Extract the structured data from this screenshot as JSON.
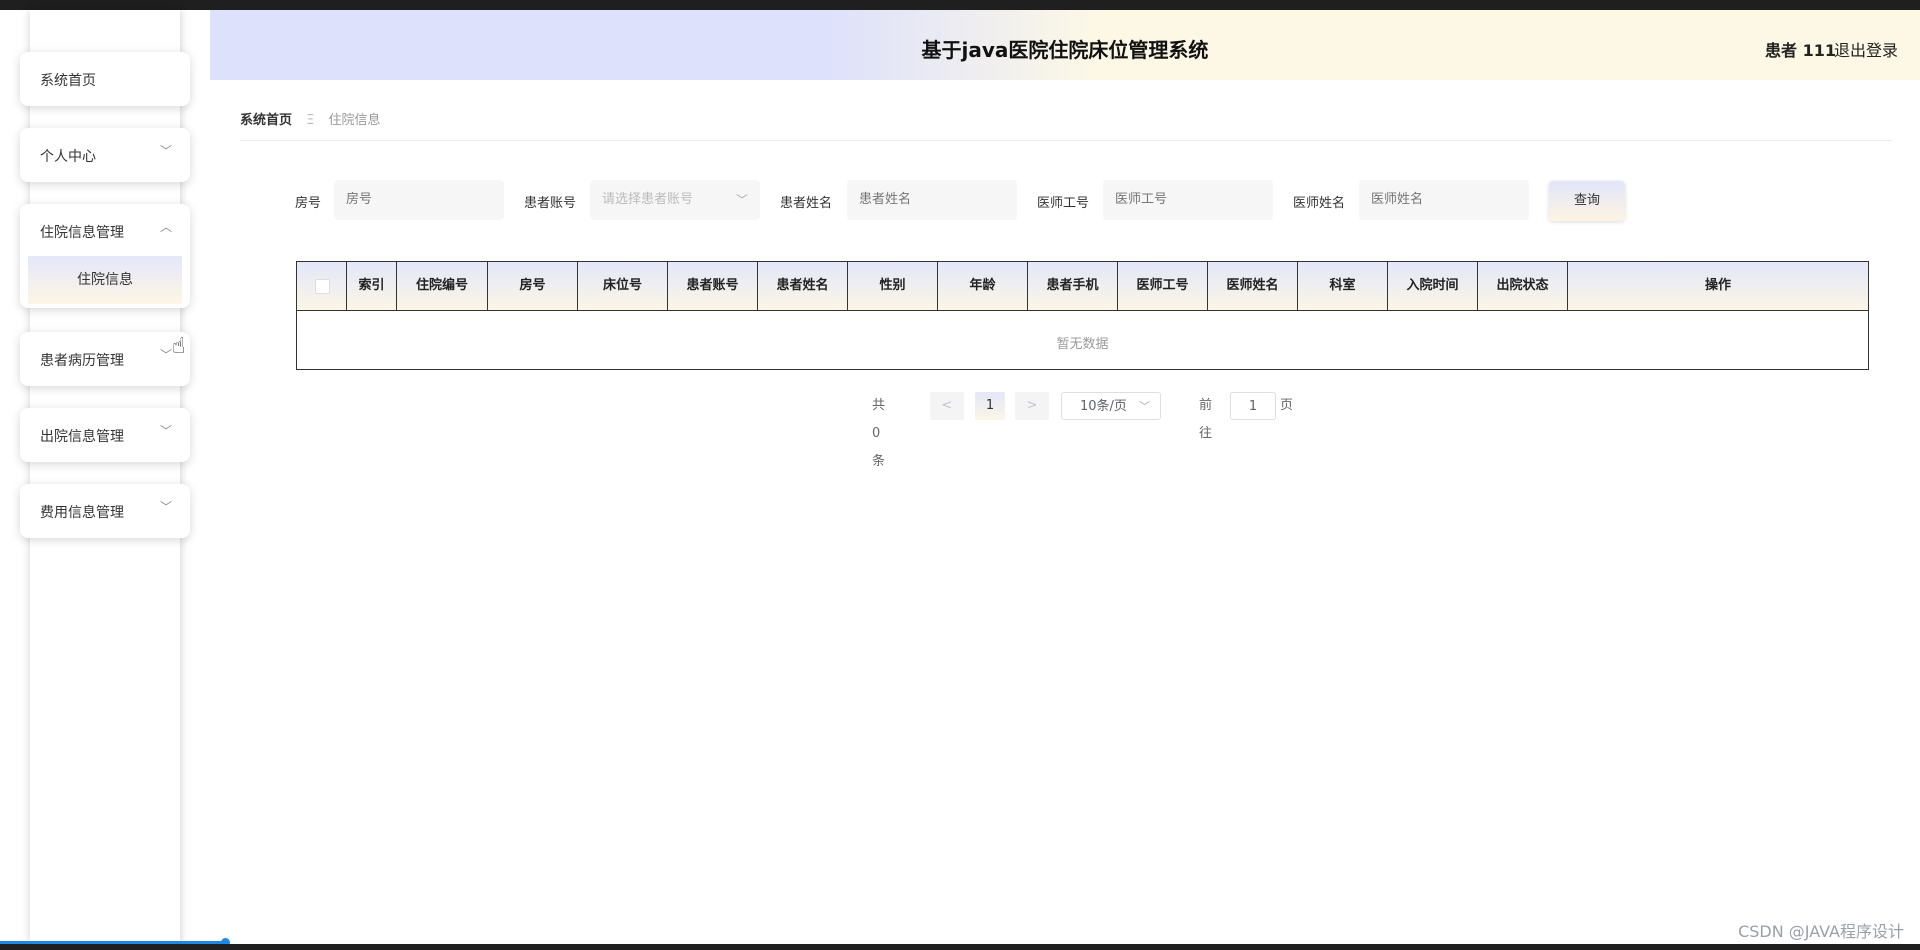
{
  "header": {
    "title": "基于java医院住院床位管理系统",
    "user": "患者 111",
    "logout": "退出登录"
  },
  "sidebar": {
    "items": [
      {
        "label": "系统首页",
        "has_children": false
      },
      {
        "label": "个人中心",
        "has_children": true,
        "expanded": false
      },
      {
        "label": "住院信息管理",
        "has_children": true,
        "expanded": true,
        "children": [
          {
            "label": "住院信息",
            "active": true
          }
        ]
      },
      {
        "label": "患者病历管理",
        "has_children": true,
        "expanded": false
      },
      {
        "label": "出院信息管理",
        "has_children": true,
        "expanded": false
      },
      {
        "label": "费用信息管理",
        "has_children": true,
        "expanded": false
      }
    ]
  },
  "breadcrumb": {
    "home": "系统首页",
    "separator": "Ξ",
    "current": "住院信息"
  },
  "search": {
    "fields": [
      {
        "label": "房号",
        "placeholder": "房号",
        "type": "input"
      },
      {
        "label": "患者账号",
        "placeholder": "请选择患者账号",
        "type": "select"
      },
      {
        "label": "患者姓名",
        "placeholder": "患者姓名",
        "type": "input"
      },
      {
        "label": "医师工号",
        "placeholder": "医师工号",
        "type": "input"
      },
      {
        "label": "医师姓名",
        "placeholder": "医师姓名",
        "type": "input"
      }
    ],
    "query_button": "查询"
  },
  "table": {
    "columns": [
      "索引",
      "住院编号",
      "房号",
      "床位号",
      "患者账号",
      "患者姓名",
      "性别",
      "年龄",
      "患者手机",
      "医师工号",
      "医师姓名",
      "科室",
      "入院时间",
      "出院状态",
      "操作"
    ],
    "rows": [],
    "empty_text": "暂无数据"
  },
  "pagination": {
    "total_text": "共 0 条",
    "prev": "<",
    "current_page": "1",
    "next": ">",
    "page_size": "10条/页",
    "goto_label": "前往",
    "goto_value": "1",
    "page_suffix": "页"
  },
  "watermark": "CSDN @JAVA程序设计",
  "colors": {
    "header_left": "#dde1fb",
    "header_right": "#fdf8e6",
    "accent_gradient_top": "#e4e6fa",
    "accent_gradient_bottom": "#fbf6e6"
  }
}
